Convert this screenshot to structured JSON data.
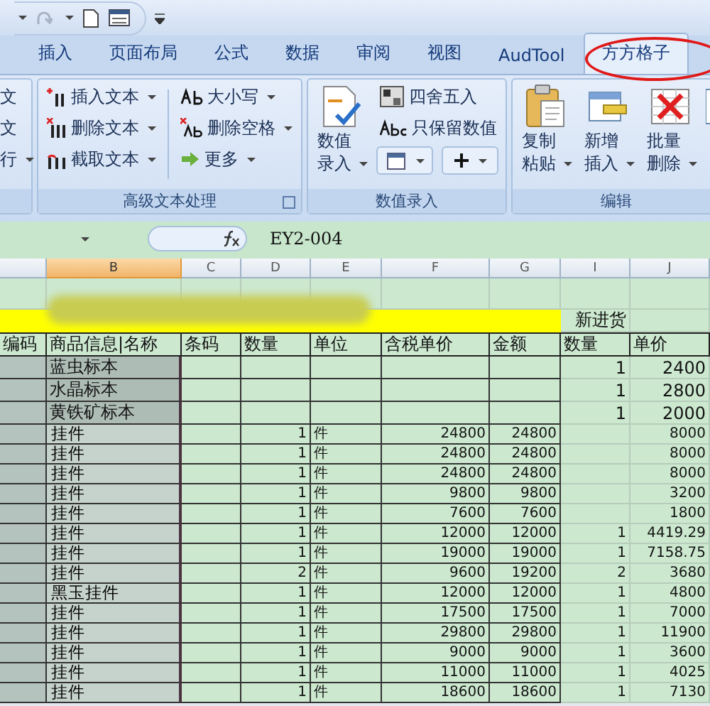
{
  "tabs": [
    {
      "label": "插入",
      "selected": false
    },
    {
      "label": "页面布局",
      "selected": false
    },
    {
      "label": "公式",
      "selected": false
    },
    {
      "label": "数据",
      "selected": false
    },
    {
      "label": "审阅",
      "selected": false
    },
    {
      "label": "视图",
      "selected": false
    },
    {
      "label": "AudTool",
      "selected": false
    },
    {
      "label": "方方格子",
      "selected": true
    }
  ],
  "ribbon_groups": [
    {
      "kind": "partial",
      "items": [
        {
          "label": "文",
          "dropdown": false
        },
        {
          "label": "文",
          "dropdown": false
        },
        {
          "label": "行",
          "dropdown": true
        }
      ]
    },
    {
      "kind": "text",
      "label": "高级文本处理",
      "launcher": true,
      "items": [
        {
          "label": "插入文本",
          "dropdown": true
        },
        {
          "label": "删除文本",
          "dropdown": true
        },
        {
          "label": "截取文本",
          "dropdown": true
        },
        {
          "label": "大小写",
          "dropdown": true
        },
        {
          "label": "删除空格",
          "dropdown": true
        },
        {
          "label": "更多",
          "dropdown": true
        }
      ]
    },
    {
      "kind": "number",
      "label": "数值录入",
      "large": {
        "label": "数值录入",
        "dropdown": true
      },
      "items": [
        {
          "label": "四舍五入"
        },
        {
          "label": "只保留数值"
        }
      ]
    },
    {
      "kind": "edit",
      "label": "编辑",
      "items": [
        {
          "label": "复制粘贴",
          "dropdown": true
        },
        {
          "label": "新增插入",
          "dropdown": true
        },
        {
          "label": "批量删除",
          "dropdown": true
        }
      ]
    }
  ],
  "formula_bar": {
    "formula": "EY2-004"
  },
  "columns": [
    {
      "selected": false
    },
    {
      "letter": "B",
      "selected": true
    },
    {
      "letter": "C",
      "selected": false
    },
    {
      "letter": "D",
      "selected": false
    },
    {
      "letter": "E",
      "selected": false
    },
    {
      "letter": "F",
      "selected": false
    },
    {
      "letter": "G",
      "selected": false
    },
    {
      "letter": "I",
      "selected": false
    },
    {
      "letter": "J",
      "selected": false
    }
  ],
  "rows": [
    {
      "kind": "empty"
    },
    {
      "kind": "banner",
      "cells": {
        "i": "新进货"
      }
    },
    {
      "kind": "header",
      "cells": {
        "a": "编码",
        "b": "商品信息|名称",
        "c": "条码",
        "d": "数量",
        "e": "单位",
        "f": "含税单价",
        "g": "金额",
        "i": "数量",
        "j": "单价"
      }
    },
    {
      "kind": "item_large",
      "cells": {
        "b": "蓝虫标本",
        "i": "1",
        "j": "2400"
      }
    },
    {
      "kind": "item_large",
      "cells": {
        "b": "水晶标本",
        "i": "1",
        "j": "2800"
      }
    },
    {
      "kind": "item_large",
      "cells": {
        "b": "黄铁矿标本",
        "i": "1",
        "j": "2000"
      }
    },
    {
      "kind": "item",
      "cells": {
        "b": "挂件",
        "d": "1",
        "e": "件",
        "f": "24800",
        "g": "24800",
        "j": "8000"
      }
    },
    {
      "kind": "item",
      "cells": {
        "b": "挂件",
        "d": "1",
        "e": "件",
        "f": "24800",
        "g": "24800",
        "j": "8000"
      }
    },
    {
      "kind": "item",
      "cells": {
        "b": "挂件",
        "d": "1",
        "e": "件",
        "f": "24800",
        "g": "24800",
        "j": "8000"
      }
    },
    {
      "kind": "item",
      "cells": {
        "b": "挂件",
        "d": "1",
        "e": "件",
        "f": "9800",
        "g": "9800",
        "j": "3200"
      }
    },
    {
      "kind": "item",
      "cells": {
        "b": "挂件",
        "d": "1",
        "e": "件",
        "f": "7600",
        "g": "7600",
        "j": "1800"
      }
    },
    {
      "kind": "item",
      "cells": {
        "b": "挂件",
        "d": "1",
        "e": "件",
        "f": "12000",
        "g": "12000",
        "i": "1",
        "j": "4419.29"
      }
    },
    {
      "kind": "item",
      "cells": {
        "b": "挂件",
        "d": "1",
        "e": "件",
        "f": "19000",
        "g": "19000",
        "i": "1",
        "j": "7158.75"
      }
    },
    {
      "kind": "item",
      "cells": {
        "b": "挂件",
        "d": "2",
        "e": "件",
        "f": "9600",
        "g": "19200",
        "i": "2",
        "j": "3680"
      }
    },
    {
      "kind": "item",
      "cells": {
        "b": "黑玉挂件",
        "d": "1",
        "e": "件",
        "f": "12000",
        "g": "12000",
        "i": "1",
        "j": "4800"
      }
    },
    {
      "kind": "item",
      "cells": {
        "b": "挂件",
        "d": "1",
        "e": "件",
        "f": "17500",
        "g": "17500",
        "i": "1",
        "j": "7000"
      }
    },
    {
      "kind": "item",
      "cells": {
        "b": "挂件",
        "d": "1",
        "e": "件",
        "f": "29800",
        "g": "29800",
        "i": "1",
        "j": "11900"
      }
    },
    {
      "kind": "item",
      "cells": {
        "b": "挂件",
        "d": "1",
        "e": "件",
        "f": "9000",
        "g": "9000",
        "i": "1",
        "j": "3600"
      }
    },
    {
      "kind": "item",
      "cells": {
        "b": "挂件",
        "d": "1",
        "e": "件",
        "f": "11000",
        "g": "11000",
        "i": "1",
        "j": "4025"
      }
    },
    {
      "kind": "item",
      "cells": {
        "b": "挂件",
        "d": "1",
        "e": "件",
        "f": "18600",
        "g": "18600",
        "i": "1",
        "j": "7130"
      }
    }
  ]
}
